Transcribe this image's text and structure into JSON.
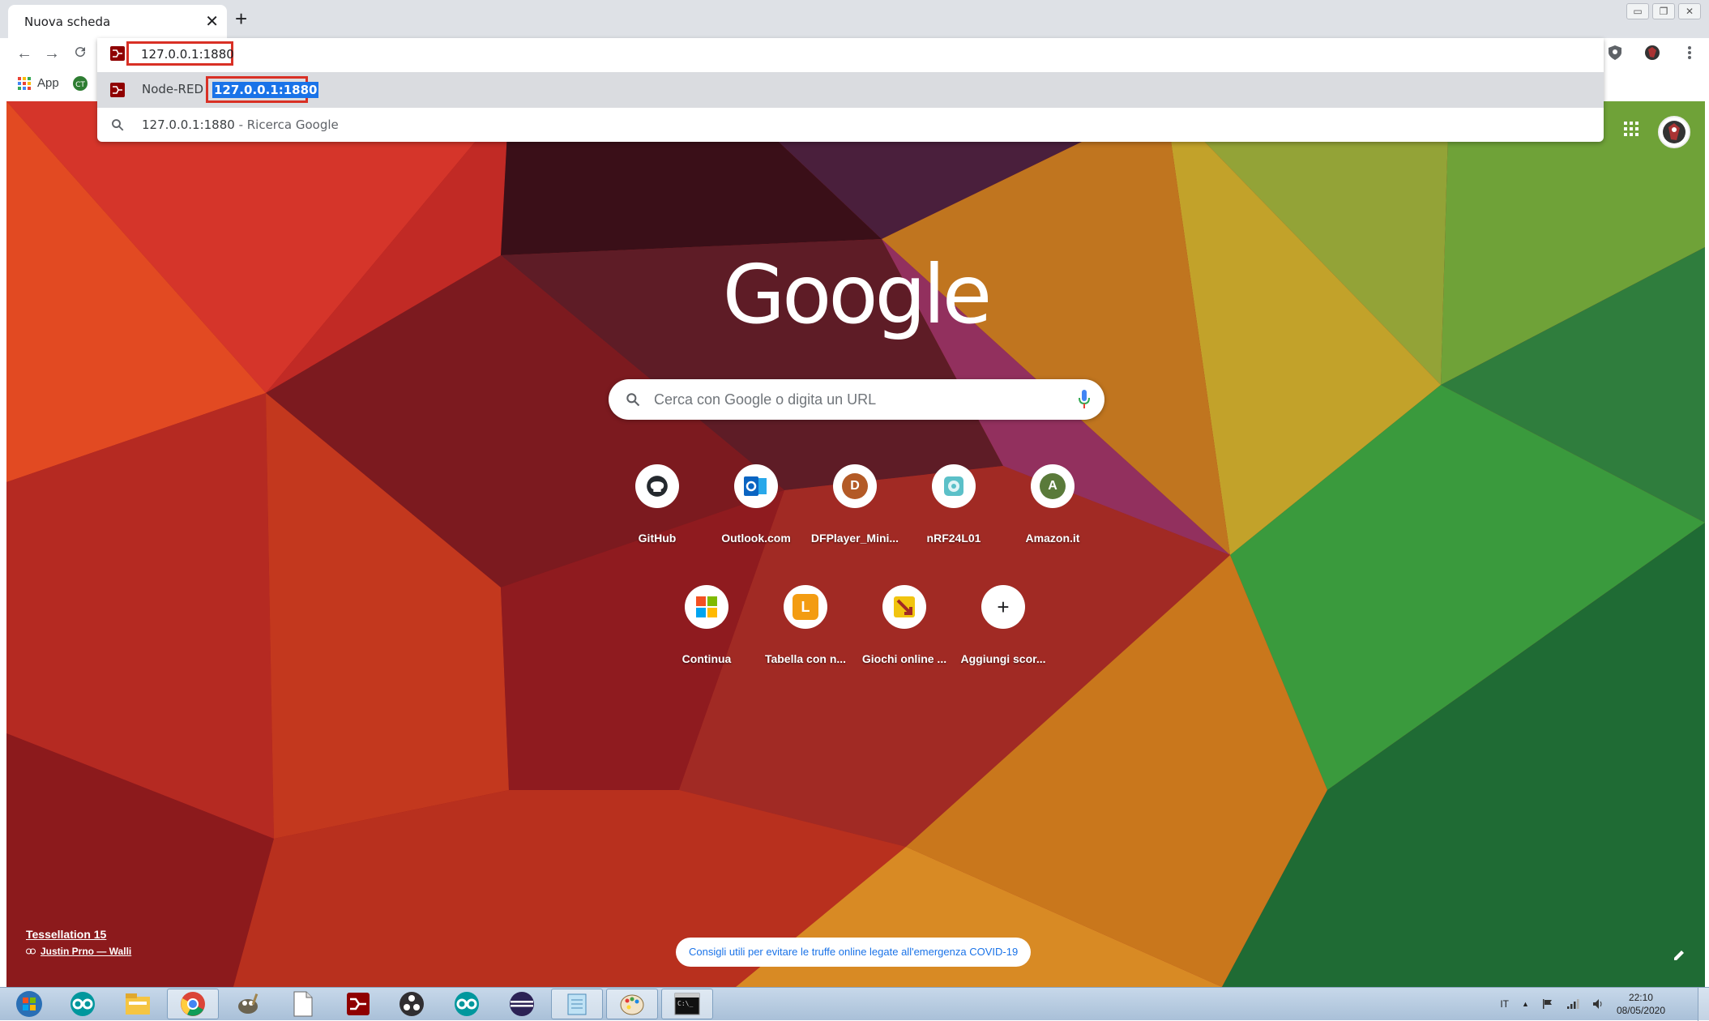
{
  "tab": {
    "title": "Nuova scheda",
    "close": "✕",
    "new_tab": "+"
  },
  "window_controls": {
    "minimize": "▭",
    "restore": "❐",
    "close": "✕"
  },
  "toolbar": {
    "back": "←",
    "forward": "→",
    "reload": "C"
  },
  "bookmarks": [
    {
      "label": "App",
      "icon": "apps-icon"
    },
    {
      "label": "",
      "icon": "ct-icon"
    }
  ],
  "omnibox": {
    "input_value": "127.0.0.1:1880",
    "suggestions": [
      {
        "title": "Node-RED",
        "url": "127.0.0.1:1880",
        "icon": "node-red-icon"
      },
      {
        "query": "127.0.0.1:1880",
        "suffix": " - Ricerca Google",
        "icon": "search-icon"
      }
    ]
  },
  "ntp": {
    "logo": "Google",
    "search_placeholder": "Cerca con Google o digita un URL",
    "shortcuts": [
      {
        "label": "GitHub",
        "glyph": "",
        "icon": "github-icon",
        "color": "#24292e"
      },
      {
        "label": "Outlook.com",
        "glyph": "o",
        "icon": "outlook-icon",
        "color": "#0a64c2"
      },
      {
        "label": "DFPlayer_Mini...",
        "glyph": "D",
        "icon": "letter-d-icon",
        "color": "#b35a26"
      },
      {
        "label": "nRF24L01",
        "glyph": "",
        "icon": "nrf-icon",
        "color": "#5bc0c8"
      },
      {
        "label": "Amazon.it",
        "glyph": "A",
        "icon": "letter-a-icon",
        "color": "#5a7a3a"
      },
      {
        "label": "Continua",
        "glyph": "",
        "icon": "microsoft-icon",
        "color": "#f25022"
      },
      {
        "label": "Tabella con n...",
        "glyph": "L",
        "icon": "letter-l-icon",
        "color": "#f39c12"
      },
      {
        "label": "Giochi online ...",
        "glyph": "",
        "icon": "games-icon",
        "color": "#f1c40f"
      },
      {
        "label": "Aggiungi scor...",
        "glyph": "+",
        "icon": "add-icon",
        "color": "#202124"
      }
    ],
    "attribution": {
      "title": "Tessellation 15",
      "author": "Justin Prno — Walli"
    },
    "promo": "Consigli utili per evitare le truffe online legate all'emergenza COVID-19"
  },
  "taskbar": {
    "items": [
      "start-orb-icon",
      "arduino-icon",
      "file-explorer-icon",
      "chrome-icon",
      "gimp-icon",
      "document-icon",
      "node-red-icon",
      "obs-icon",
      "arduino-icon",
      "eclipse-icon",
      "notepad-icon",
      "paint-icon",
      "cmd-icon"
    ],
    "language": "IT",
    "tray": {
      "up_arrow": "▲"
    },
    "time": "22:10",
    "date": "08/05/2020"
  }
}
